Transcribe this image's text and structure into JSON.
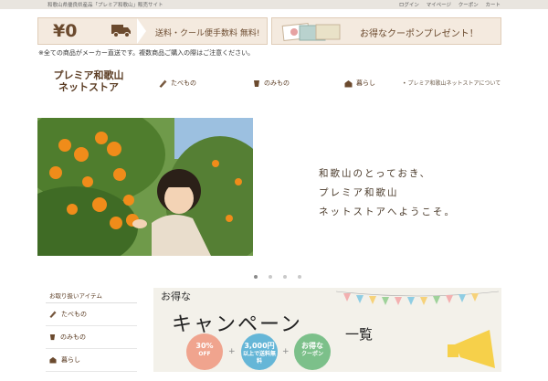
{
  "topbar": {
    "tagline": "和歌山県優良県産品「プレミア和歌山」販売サイト",
    "links": [
      "ログイン",
      "マイページ",
      "クーポン",
      "カート"
    ]
  },
  "banners": {
    "shipping_amount": "¥0",
    "shipping_text": "送料・クール便手数料 無料!",
    "coupon_text": "お得なクーポンプレゼント！"
  },
  "notice": "※全ての商品がメーカー直送です。複数商品ご購入の際はご注意ください。",
  "logo": {
    "line1": "プレミア和歌山",
    "line2": "ネットストア"
  },
  "nav": {
    "food": "たべもの",
    "drink": "のみもの",
    "life": "暮らし",
    "about": "プレミア和歌山ネットストアについて"
  },
  "hero": {
    "line1": "和歌山のとっておき、",
    "line2": "プレミア和歌山",
    "line3": "ネットストアへようこそ。"
  },
  "slider": {
    "count": 4,
    "active_index": 0
  },
  "sidebar": {
    "heading": "お取り扱いアイテム",
    "items": [
      {
        "label": "たべもの"
      },
      {
        "label": "のみもの"
      },
      {
        "label": "暮らし"
      }
    ]
  },
  "campaign": {
    "small": "お得な",
    "big": "キャンペーン",
    "ichiran": "一覧",
    "badge1_l1": "30%",
    "badge1_l2": "OFF",
    "badge2_l1": "3,000円",
    "badge2_l2": "以上で送料無料",
    "badge3_l1": "お得な",
    "badge3_l2": "クーポン",
    "plus": "+"
  },
  "colors": {
    "brand_brown": "#6b4a2e",
    "banner_bg": "#f4eadf",
    "badge_pink": "#f0a48e",
    "badge_blue": "#65b6d7",
    "badge_green": "#7cc08a"
  }
}
